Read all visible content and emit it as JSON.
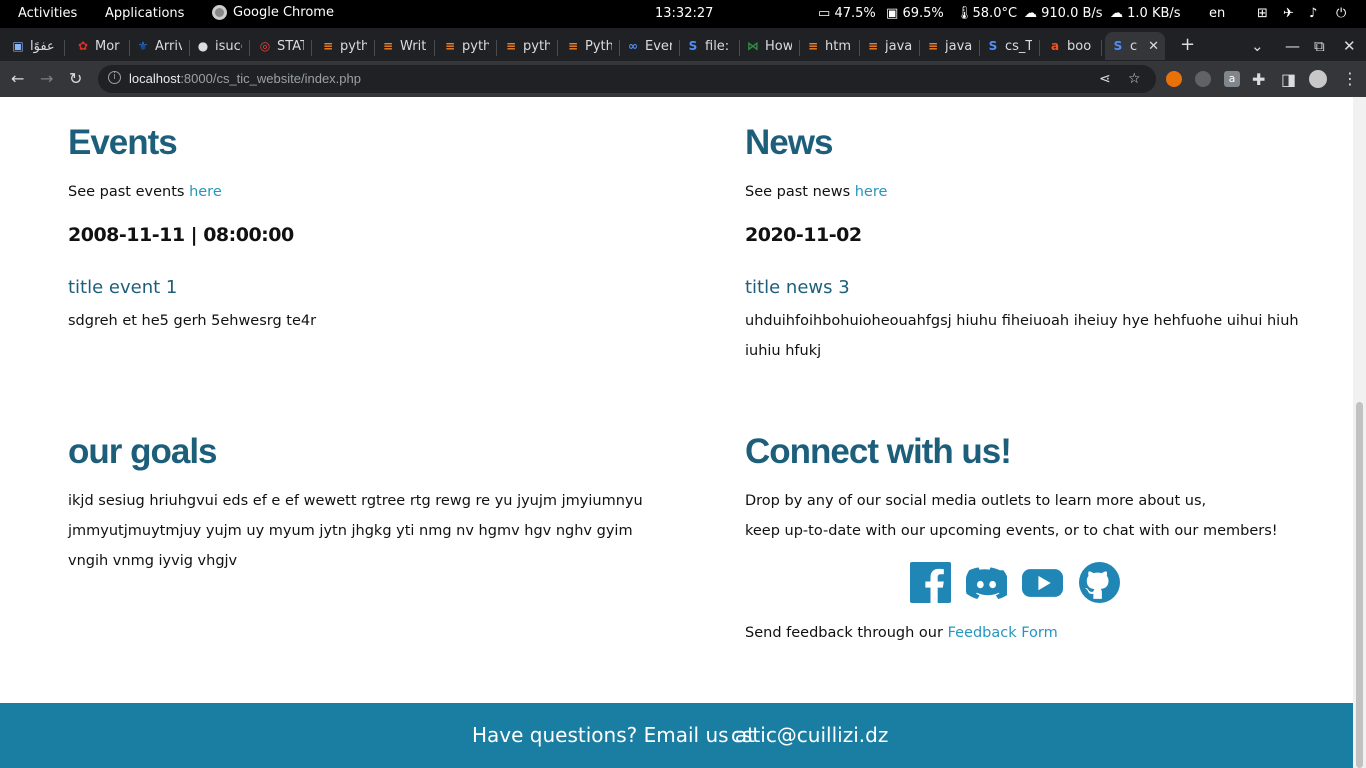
{
  "system_bar": {
    "activities": "Activities",
    "applications": "Applications",
    "app_name": "Google Chrome",
    "clock": "13:32:27",
    "battery": "47.5%",
    "memory": "69.5%",
    "temperature": "58.0°C",
    "download": "910.0 B/s",
    "upload": "1.0 KB/s",
    "language": "en"
  },
  "tabs": [
    {
      "label": "عفوًا",
      "icon": "car-icon",
      "color": "#8ab4f8"
    },
    {
      "label": "Mor",
      "icon": "maple-leaf-icon",
      "color": "#d93025"
    },
    {
      "label": "Arriv",
      "icon": "fleur-de-lis-icon",
      "color": "#1a73e8"
    },
    {
      "label": "isucc",
      "icon": "github-icon",
      "color": "#dadce0"
    },
    {
      "label": "STAT",
      "icon": "target-icon",
      "color": "#e8453c"
    },
    {
      "label": "pyth",
      "icon": "stackoverflow-icon",
      "color": "#f48024"
    },
    {
      "label": "Writ",
      "icon": "stackoverflow-icon",
      "color": "#f48024"
    },
    {
      "label": "pyth",
      "icon": "stackoverflow-icon",
      "color": "#f48024"
    },
    {
      "label": "pyth",
      "icon": "stackoverflow-icon",
      "color": "#f48024"
    },
    {
      "label": "Pyth",
      "icon": "stackoverflow-icon",
      "color": "#f48024"
    },
    {
      "label": "Ever",
      "icon": "infinity-icon",
      "color": "#4f8ff7"
    },
    {
      "label": "file:",
      "icon": "s-logo-icon",
      "color": "#4f8ff7"
    },
    {
      "label": "How",
      "icon": "geeks-icon",
      "color": "#2f8d46"
    },
    {
      "label": "htm",
      "icon": "stackoverflow-icon",
      "color": "#f48024"
    },
    {
      "label": "java",
      "icon": "stackoverflow-icon",
      "color": "#f48024"
    },
    {
      "label": "java",
      "icon": "stackoverflow-icon",
      "color": "#f48024"
    },
    {
      "label": "cs_T",
      "icon": "s-logo-icon",
      "color": "#4f8ff7"
    },
    {
      "label": "boo",
      "icon": "ask-icon",
      "color": "#f4511e"
    }
  ],
  "active_tab": {
    "label": "c",
    "icon": "s-logo-icon",
    "close": "✕"
  },
  "address_bar": {
    "host": "localhost",
    "path": ":8000/cs_tic_website/index.php"
  },
  "page": {
    "events": {
      "heading": "Events",
      "past_text": "See past events ",
      "past_link": "here",
      "date": "2008-11-11 | 08:00:00",
      "item_title": "title event 1",
      "item_body": "sdgreh et he5 gerh 5ehwesrg te4r"
    },
    "news": {
      "heading": "News",
      "past_text": "See past news ",
      "past_link": "here",
      "date": "2020-11-02",
      "item_title": "title news 3",
      "item_body_line1": "uhduihfoihbohuioheouahfgsj hiuhu fiheiuoah iheiuy hye hehfuohe uihui hiuh",
      "item_body_line2": "iuhiu hfukj"
    },
    "goals": {
      "heading": "our goals",
      "line1": "ikjd sesiug hriuhgvui eds ef e ef wewett rgtree rtg rewg re yu jyujm jmyiumnyu",
      "line2": "jmmyutjmuytmjuy yujm uy myum jytn jhgkg yti nmg nv hgmv hgv nghv gyim",
      "line3": "vngih vnmg iyvig vhgjv"
    },
    "connect": {
      "heading": "Connect with us!",
      "line1": "Drop by any of our social media outlets to learn more about us,",
      "line2": "keep up-to-date with our upcoming events, or to chat with our members!",
      "feedback_text": "Send feedback through our ",
      "feedback_link": "Feedback Form",
      "social_icons": [
        "facebook-icon",
        "discord-icon",
        "youtube-icon",
        "github-icon"
      ]
    },
    "footer": {
      "text": "Have questions? Email us at",
      "email": "cstic@cuillizi.dz"
    }
  },
  "colors": {
    "heading": "#1d5f7b",
    "link": "#2596be",
    "footer_bg": "#1a7ea3",
    "social": "#1f86b5"
  }
}
